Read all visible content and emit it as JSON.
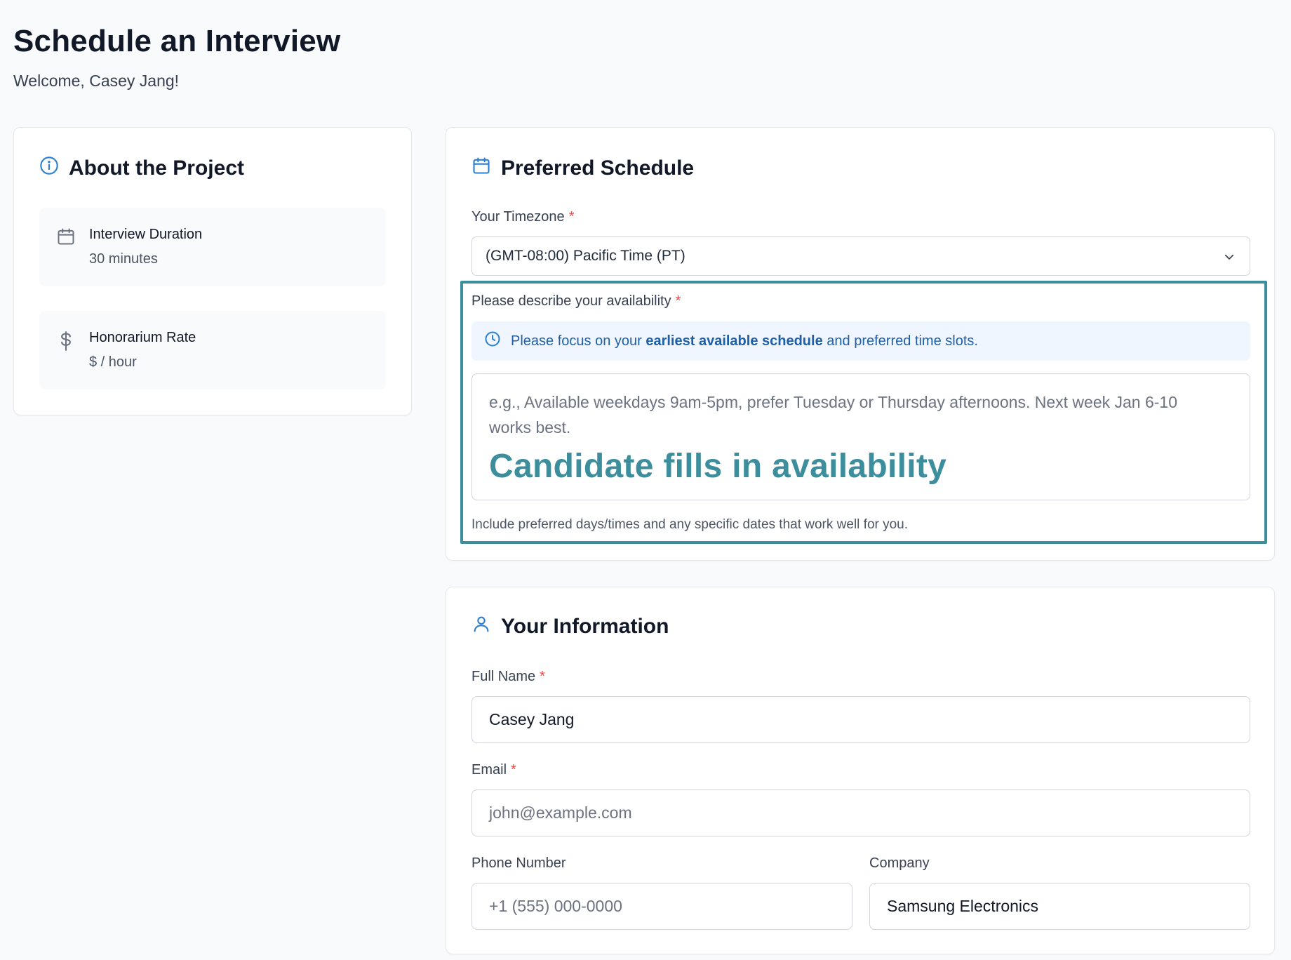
{
  "header": {
    "title": "Schedule an Interview",
    "welcome": "Welcome, Casey Jang!"
  },
  "about": {
    "title": "About the Project",
    "icon": "info-icon",
    "items": [
      {
        "icon": "calendar-icon",
        "label": "Interview Duration",
        "value": "30 minutes"
      },
      {
        "icon": "dollar-icon",
        "label": "Honorarium Rate",
        "value": "$ / hour"
      }
    ]
  },
  "schedule": {
    "title": "Preferred Schedule",
    "icon": "calendar-icon",
    "timezone_label": "Your Timezone",
    "timezone_value": "(GMT-08:00) Pacific Time (PT)",
    "availability_label": "Please describe your availability",
    "notice_prefix": "Please focus on your",
    "notice_bold": "earliest available schedule",
    "notice_suffix": "and preferred time slots.",
    "availability_placeholder": "e.g., Available weekdays 9am-5pm, prefer Tuesday or Thursday afternoons. Next week Jan 6-10 works best.",
    "annotation": "Candidate fills in availability",
    "help_text": "Include preferred days/times and any specific dates that work well for you.",
    "required_mark": "*"
  },
  "info": {
    "title": "Your Information",
    "icon": "user-icon",
    "full_name_label": "Full Name",
    "full_name_value": "Casey Jang",
    "email_label": "Email",
    "email_placeholder": "john@example.com",
    "phone_label": "Phone Number",
    "phone_placeholder": "+1 (555) 000-0000",
    "company_label": "Company",
    "company_value": "Samsung Electronics"
  },
  "colors": {
    "accent_blue": "#2b7fd0",
    "highlight_teal": "#3c8e9c",
    "required_red": "#ef4444"
  }
}
